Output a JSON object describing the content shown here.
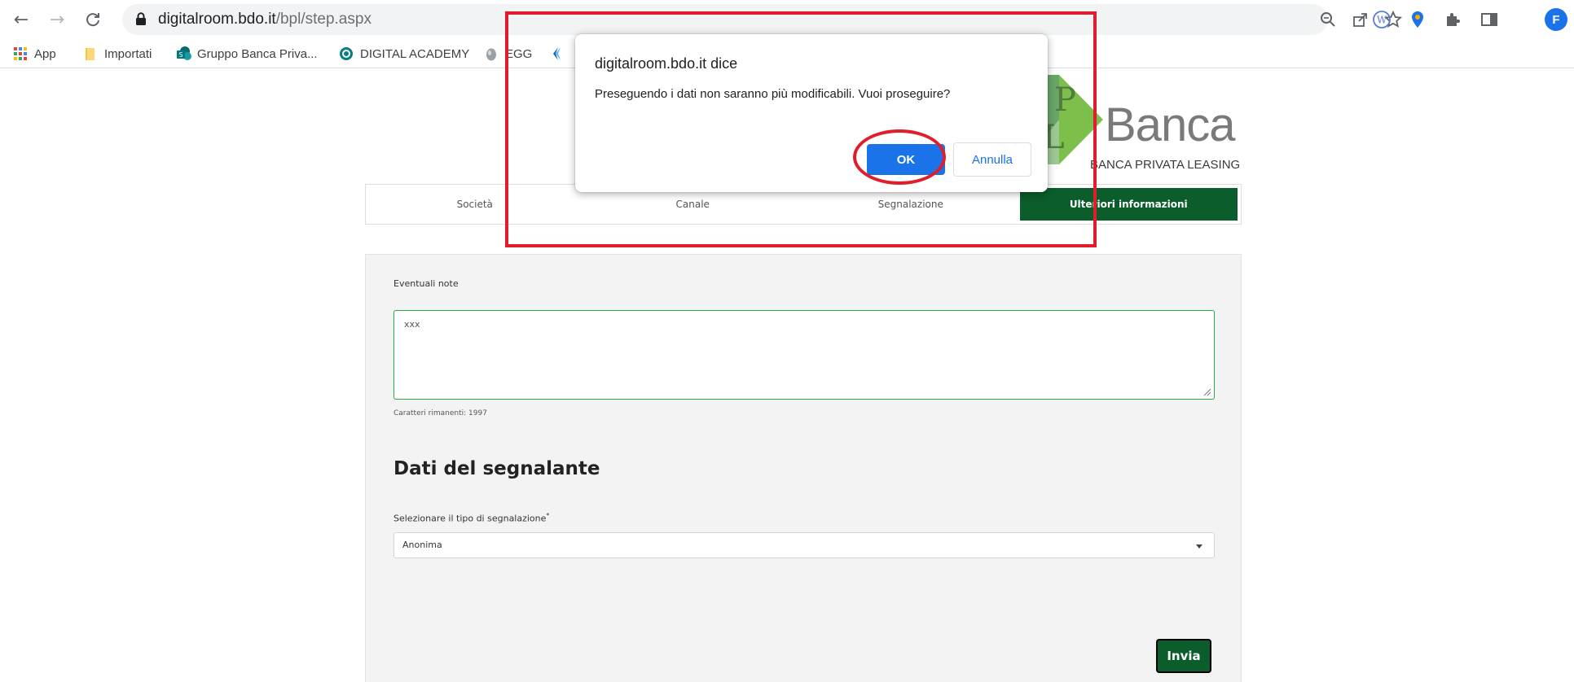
{
  "browser": {
    "url_host": "digitalroom.bdo.it",
    "url_path": "/bpl/step.aspx",
    "profile_initial": "F",
    "bookmarks": [
      {
        "label": "App",
        "icon": "apps-grid-icon"
      },
      {
        "label": "Importati",
        "icon": "folder-icon"
      },
      {
        "label": "Gruppo Banca Priva...",
        "icon": "sharepoint-icon"
      },
      {
        "label": "DIGITAL ACADEMY",
        "icon": "academy-icon"
      },
      {
        "label": "EGG",
        "icon": "egg-icon"
      }
    ]
  },
  "logo": {
    "word": "Banca",
    "subtitle": "BANCA PRIVATA LEASING"
  },
  "steps": [
    {
      "label": "Società"
    },
    {
      "label": "Canale"
    },
    {
      "label": "Segnalazione"
    },
    {
      "label": "Ulteriori informazioni",
      "active": true
    }
  ],
  "form": {
    "notes_label": "Eventuali note",
    "notes_value": "xxx",
    "remaining_chars": "Caratteri rimanenti: 1997",
    "section_title": "Dati del segnalante",
    "select_label": "Selezionare il tipo di segnalazione",
    "select_required_mark": "*",
    "select_value": "Anonima",
    "submit_label": "Invia"
  },
  "dialog": {
    "title": "digitalroom.bdo.it dice",
    "message": "Preseguendo i dati non saranno più modificabili. Vuoi proseguire?",
    "ok_label": "OK",
    "cancel_label": "Annulla"
  },
  "colors": {
    "brand_green": "#0b5d2b",
    "dialog_blue": "#1a73e8",
    "annotation_red": "#e11d2b"
  }
}
